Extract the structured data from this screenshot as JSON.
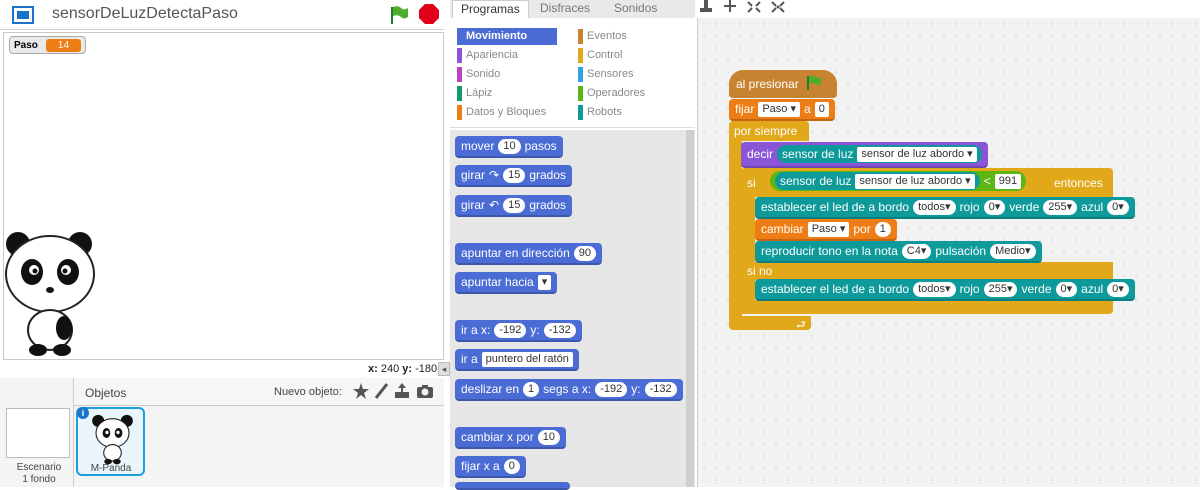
{
  "stage": {
    "project_title": "sensorDeLuzDetectaPaso",
    "variable_monitor": {
      "name": "Paso",
      "value": "14"
    },
    "coords": {
      "x_label": "x:",
      "x_value": "240",
      "y_label": "y:",
      "y_value": "-180"
    }
  },
  "sprites": {
    "header_label": "Objetos",
    "new_object_label": "Nuevo objeto:",
    "scene": {
      "label": "Escenario",
      "sub": "1 fondo"
    },
    "sprite": {
      "label": "M-Panda"
    }
  },
  "tabs": [
    "Programas",
    "Disfraces",
    "Sonidos"
  ],
  "categories": {
    "left": [
      {
        "label": "Movimiento",
        "color": "#4a6cd4",
        "active": true
      },
      {
        "label": "Apariencia",
        "color": "#8a55d7"
      },
      {
        "label": "Sonido",
        "color": "#bb42c3"
      },
      {
        "label": "Lápiz",
        "color": "#0e9a6c"
      },
      {
        "label": "Datos y Bloques",
        "color": "#ee7d16"
      }
    ],
    "right": [
      {
        "label": "Eventos",
        "color": "#c88330"
      },
      {
        "label": "Control",
        "color": "#e1a91a"
      },
      {
        "label": "Sensores",
        "color": "#2ca5e2"
      },
      {
        "label": "Operadores",
        "color": "#5cb712"
      },
      {
        "label": "Robots",
        "color": "#0e9a9a"
      }
    ]
  },
  "palette": {
    "mover": {
      "t1": "mover",
      "v": "10",
      "t2": "pasos"
    },
    "girar_r": {
      "t1": "girar",
      "v": "15",
      "t2": "grados"
    },
    "girar_l": {
      "t1": "girar",
      "v": "15",
      "t2": "grados"
    },
    "apuntar_dir": {
      "t1": "apuntar en dirección",
      "v": "90"
    },
    "apuntar_hacia": {
      "t1": "apuntar hacia"
    },
    "ir_xy": {
      "t1": "ir a x:",
      "x": "-192",
      "t2": "y:",
      "y": "-132"
    },
    "ir_a": {
      "t1": "ir a",
      "v": "puntero del ratón"
    },
    "deslizar": {
      "t1": "deslizar en",
      "s": "1",
      "t2": "segs a x:",
      "x": "-192",
      "t3": "y:",
      "y": "-132"
    },
    "cambiar_x": {
      "t1": "cambiar x por",
      "v": "10"
    },
    "fijar_x": {
      "t1": "fijar x a",
      "v": "0"
    }
  },
  "script": {
    "hat": "al presionar",
    "fijar": {
      "t1": "fijar",
      "var": "Paso",
      "t2": "a",
      "v": "0"
    },
    "forever": "por siempre",
    "decir": {
      "t1": "decir",
      "s1": "sensor de luz",
      "s2": "sensor de luz abordo"
    },
    "si": {
      "t1": "si",
      "s1": "sensor de luz",
      "s2": "sensor de luz abordo",
      "op": "<",
      "v": "991",
      "t2": "entonces"
    },
    "led1": {
      "t1": "establecer el led de a bordo",
      "which": "todos",
      "r": "rojo",
      "rv": "0",
      "g": "verde",
      "gv": "255",
      "b": "azul",
      "bv": "0"
    },
    "cambiar": {
      "t1": "cambiar",
      "var": "Paso",
      "t2": "por",
      "v": "1"
    },
    "tono": {
      "t1": "reproducir tono en la nota",
      "nota": "C4",
      "t2": "pulsación",
      "p": "Medio"
    },
    "sino": "si no",
    "led2": {
      "t1": "establecer el led de a bordo",
      "which": "todos",
      "r": "rojo",
      "rv": "255",
      "g": "verde",
      "gv": "0",
      "b": "azul",
      "bv": "0"
    }
  }
}
